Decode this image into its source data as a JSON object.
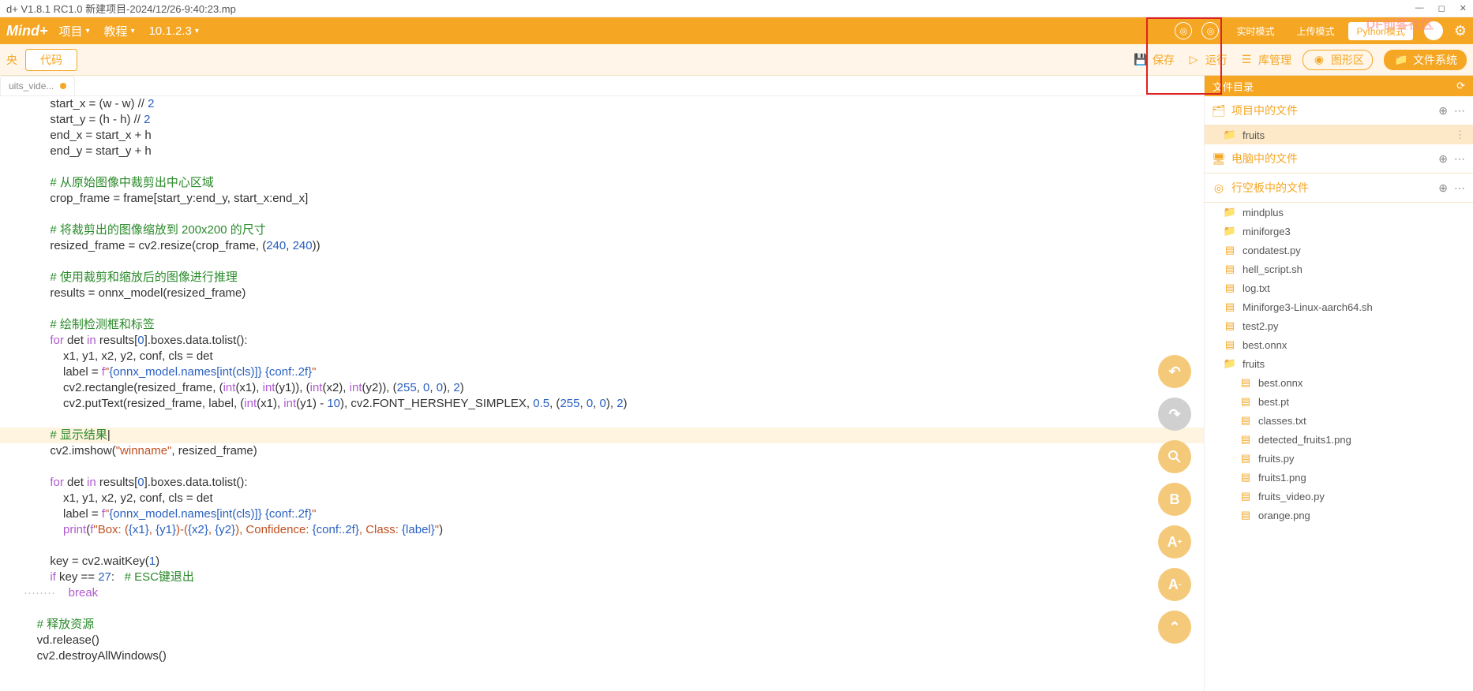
{
  "title_bar": "d+ V1.8.1 RC1.0  新建项目-2024/12/26-9:40:23.mp",
  "watermark": "DF创客社区",
  "menu": {
    "logo": "Mind+",
    "project": "项目",
    "tutorial": "教程",
    "version": "10.1.2.3"
  },
  "modes": {
    "realtime": "实时模式",
    "upload": "上传模式",
    "python": "Python模式"
  },
  "toolbar": {
    "left": "央",
    "code": "代码",
    "save": "保存",
    "run": "运行",
    "lib": "库管理",
    "graph": "图形区",
    "files": "文件系统"
  },
  "tab": {
    "name": "uits_vide..."
  },
  "side": {
    "header": "文件目录",
    "sect1": "项目中的文件",
    "folder1": "fruits",
    "sect2": "电脑中的文件",
    "sect3": "行空板中的文件",
    "tree": [
      {
        "t": "folder",
        "n": "mindplus",
        "d": 1
      },
      {
        "t": "folder",
        "n": "miniforge3",
        "d": 1
      },
      {
        "t": "file",
        "n": "condatest.py",
        "d": 1
      },
      {
        "t": "file",
        "n": "hell_script.sh",
        "d": 1
      },
      {
        "t": "file",
        "n": "log.txt",
        "d": 1
      },
      {
        "t": "file",
        "n": "Miniforge3-Linux-aarch64.sh",
        "d": 1
      },
      {
        "t": "file",
        "n": "test2.py",
        "d": 1
      },
      {
        "t": "file",
        "n": "best.onnx",
        "d": 1
      },
      {
        "t": "folder",
        "n": "fruits",
        "d": 1,
        "open": true
      },
      {
        "t": "file",
        "n": "best.onnx",
        "d": 2
      },
      {
        "t": "file",
        "n": "best.pt",
        "d": 2
      },
      {
        "t": "file",
        "n": "classes.txt",
        "d": 2
      },
      {
        "t": "file",
        "n": "detected_fruits1.png",
        "d": 2
      },
      {
        "t": "file",
        "n": "fruits.py",
        "d": 2
      },
      {
        "t": "file",
        "n": "fruits1.png",
        "d": 2
      },
      {
        "t": "file",
        "n": "fruits_video.py",
        "d": 2
      },
      {
        "t": "file",
        "n": "orange.png",
        "d": 2
      }
    ]
  },
  "float": [
    "↶",
    "↷",
    "🔍",
    "B",
    "A+",
    "A-",
    "⌃"
  ],
  "code_lines": [
    {
      "i": 8,
      "h": "        start_x = (w - w) // <span class='c-nm'>2</span>"
    },
    {
      "i": 8,
      "h": "        start_y = (h - h) // <span class='c-nm'>2</span>"
    },
    {
      "i": 8,
      "h": "        end_x = start_x + h"
    },
    {
      "i": 8,
      "h": "        end_y = start_y + h"
    },
    {
      "i": 8,
      "h": ""
    },
    {
      "i": 8,
      "h": "        <span class='c-cm'># 从原始图像中裁剪出中心区域</span>"
    },
    {
      "i": 8,
      "h": "        crop_frame = frame[start_y:end_y, start_x:end_x]"
    },
    {
      "i": 8,
      "h": ""
    },
    {
      "i": 8,
      "h": "        <span class='c-cm'># 将裁剪出的图像缩放到 200x200 的尺寸</span>"
    },
    {
      "i": 8,
      "h": "        resized_frame = cv2.resize(crop_frame, (<span class='c-nm'>240</span>, <span class='c-nm'>240</span>))"
    },
    {
      "i": 8,
      "h": ""
    },
    {
      "i": 8,
      "h": "        <span class='c-cm'># 使用裁剪和缩放后的图像进行推理</span>"
    },
    {
      "i": 8,
      "h": "        results = onnx_model(resized_frame)"
    },
    {
      "i": 8,
      "h": ""
    },
    {
      "i": 8,
      "h": "        <span class='c-cm'># 绘制检测框和标签</span>"
    },
    {
      "i": 8,
      "h": "        <span class='c-kw'>for</span> det <span class='c-kw'>in</span> results[<span class='c-nm'>0</span>].boxes.data.tolist():"
    },
    {
      "i": 12,
      "h": "            x1, y1, x2, y2, conf, cls = det"
    },
    {
      "i": 12,
      "h": "            label = <span class='c-kw'>f</span><span class='c-st'>&quot;</span><span class='c-bk'>{onnx_model.names[int(cls)]} {conf:.2f}</span><span class='c-st'>&quot;</span>"
    },
    {
      "i": 12,
      "h": "            cv2.rectangle(resized_frame, (<span class='c-kw'>int</span>(x1), <span class='c-kw'>int</span>(y1)), (<span class='c-kw'>int</span>(x2), <span class='c-kw'>int</span>(y2)), (<span class='c-nm'>255</span>, <span class='c-nm'>0</span>, <span class='c-nm'>0</span>), <span class='c-nm'>2</span>)"
    },
    {
      "i": 12,
      "h": "            cv2.putText(resized_frame, label, (<span class='c-kw'>int</span>(x1), <span class='c-kw'>int</span>(y1) - <span class='c-nm'>10</span>), cv2.FONT_HERSHEY_SIMPLEX, <span class='c-nm'>0.5</span>, (<span class='c-nm'>255</span>, <span class='c-nm'>0</span>, <span class='c-nm'>0</span>), <span class='c-nm'>2</span>)"
    },
    {
      "i": 8,
      "h": ""
    },
    {
      "i": 8,
      "hl": true,
      "h": "        <span class='c-cm'># 显示结果</span>|"
    },
    {
      "i": 8,
      "h": "        cv2.imshow(<span class='c-st'>&quot;winname&quot;</span>, resized_frame)"
    },
    {
      "i": 8,
      "h": ""
    },
    {
      "i": 8,
      "h": "        <span class='c-kw'>for</span> det <span class='c-kw'>in</span> results[<span class='c-nm'>0</span>].boxes.data.tolist():"
    },
    {
      "i": 12,
      "h": "            x1, y1, x2, y2, conf, cls = det"
    },
    {
      "i": 12,
      "h": "            label = <span class='c-kw'>f</span><span class='c-st'>&quot;</span><span class='c-bk'>{onnx_model.names[int(cls)]} {conf:.2f}</span><span class='c-st'>&quot;</span>"
    },
    {
      "i": 12,
      "h": "            <span class='c-kw'>print</span>(<span class='c-kw'>f</span><span class='c-st'>&quot;Box: (</span><span class='c-bk'>{x1}</span><span class='c-st'>, </span><span class='c-bk'>{y1}</span><span class='c-st'>)-(</span><span class='c-bk'>{x2}</span><span class='c-st'>, </span><span class='c-bk'>{y2}</span><span class='c-st'>), Confidence: </span><span class='c-bk'>{conf:.2f}</span><span class='c-st'>, Class: </span><span class='c-bk'>{label}</span><span class='c-st'>&quot;</span>)"
    },
    {
      "i": 8,
      "h": ""
    },
    {
      "i": 8,
      "h": "        key = cv2.waitKey(<span class='c-nm'>1</span>)"
    },
    {
      "i": 8,
      "h": "        <span class='c-kw'>if</span> key == <span class='c-nm'>27</span>:   <span class='c-cm'># ESC键退出</span>"
    },
    {
      "i": 12,
      "h": "<span style='color:#bbb'>········</span>    <span class='c-kw'>break</span>"
    },
    {
      "i": 0,
      "h": ""
    },
    {
      "i": 0,
      "h": "    <span class='c-cm'># 释放资源</span>"
    },
    {
      "i": 0,
      "h": "    vd.release()"
    },
    {
      "i": 0,
      "h": "    cv2.destroyAllWindows()"
    }
  ]
}
